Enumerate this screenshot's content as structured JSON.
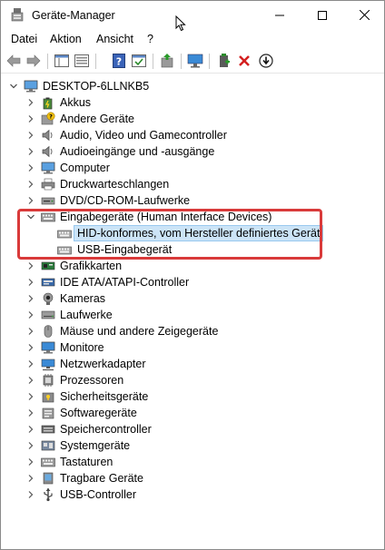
{
  "window": {
    "title": "Geräte-Manager",
    "icon": "device-manager-icon"
  },
  "menu": [
    "Datei",
    "Aktion",
    "Ansicht",
    "?"
  ],
  "toolbar": {
    "icons": [
      "back-arrow-icon",
      "forward-arrow-icon",
      "show-hide-tree-icon",
      "properties-icon",
      "help-icon",
      "action-icon",
      "update-driver-icon",
      "scan-hardware-icon",
      "add-driver-icon",
      "uninstall-icon",
      "disable-device-icon"
    ]
  },
  "tree": {
    "root": "DESKTOP-6LLNKB5",
    "categories": [
      {
        "label": "Akkus",
        "icon": "battery-icon"
      },
      {
        "label": "Andere Geräte",
        "icon": "unknown-device-icon"
      },
      {
        "label": "Audio, Video und Gamecontroller",
        "icon": "speaker-icon"
      },
      {
        "label": "Audioeingänge und -ausgänge",
        "icon": "speaker-icon"
      },
      {
        "label": "Computer",
        "icon": "computer-icon"
      },
      {
        "label": "Druckwarteschlangen",
        "icon": "printer-icon"
      },
      {
        "label": "DVD/CD-ROM-Laufwerke",
        "icon": "dvd-drive-icon"
      },
      {
        "label": "Eingabegeräte (Human Interface Devices)",
        "icon": "keyboard-icon",
        "expanded": true,
        "children": [
          {
            "label": "HID-konformes, vom Hersteller definiertes Gerät",
            "icon": "hid-device-icon",
            "selected": true
          },
          {
            "label": "USB-Eingabegerät",
            "icon": "hid-device-icon"
          }
        ]
      },
      {
        "label": "Grafikkarten",
        "icon": "display-adapter-icon"
      },
      {
        "label": "IDE ATA/ATAPI-Controller",
        "icon": "ide-controller-icon"
      },
      {
        "label": "Kameras",
        "icon": "camera-icon"
      },
      {
        "label": "Laufwerke",
        "icon": "disk-drive-icon"
      },
      {
        "label": "Mäuse und andere Zeigegeräte",
        "icon": "mouse-icon"
      },
      {
        "label": "Monitore",
        "icon": "monitor-icon"
      },
      {
        "label": "Netzwerkadapter",
        "icon": "network-adapter-icon"
      },
      {
        "label": "Prozessoren",
        "icon": "processor-icon"
      },
      {
        "label": "Sicherheitsgeräte",
        "icon": "security-device-icon"
      },
      {
        "label": "Softwaregeräte",
        "icon": "software-device-icon"
      },
      {
        "label": "Speichercontroller",
        "icon": "storage-controller-icon"
      },
      {
        "label": "Systemgeräte",
        "icon": "system-device-icon"
      },
      {
        "label": "Tastaturen",
        "icon": "keyboard-icon"
      },
      {
        "label": "Tragbare Geräte",
        "icon": "portable-device-icon"
      },
      {
        "label": "USB-Controller",
        "icon": "usb-controller-icon"
      }
    ]
  },
  "colors": {
    "highlight_border": "#d93a3a",
    "selection_bg": "#cce4f7",
    "selection_border": "#99c9ef"
  }
}
